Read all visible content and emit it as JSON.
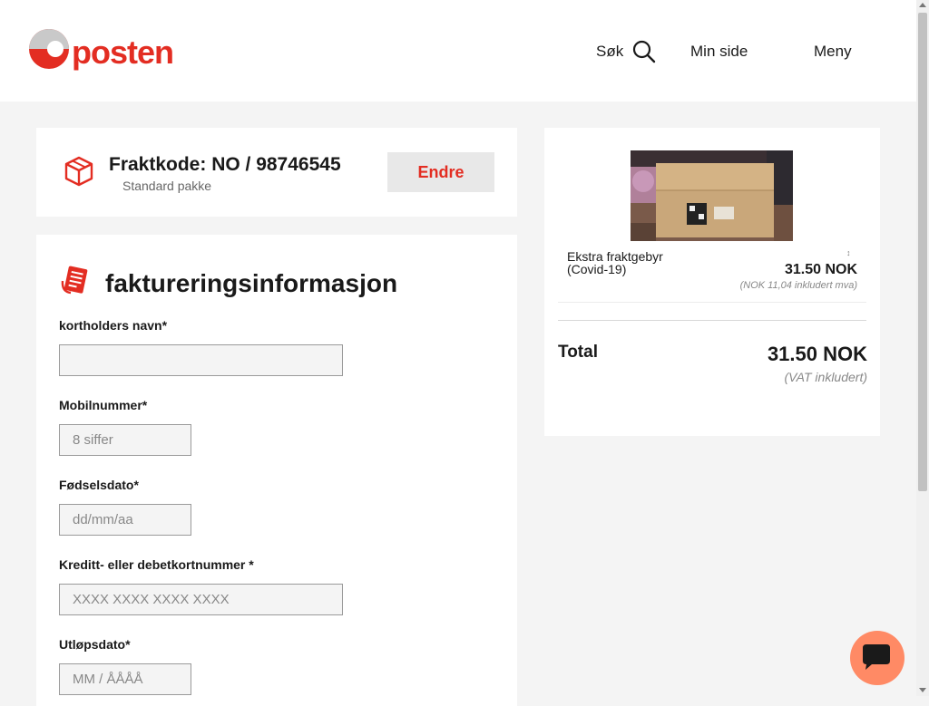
{
  "header": {
    "logo_text": "posten",
    "search_label": "Søk",
    "nav": {
      "min_side": "Min side",
      "meny": "Meny"
    }
  },
  "freight": {
    "code_label": "Fraktkode: NO / 98746545",
    "type": "Standard pakke",
    "change_button": "Endre"
  },
  "billing": {
    "title": "faktureringsinformasjon",
    "fields": [
      {
        "label": "kortholders navn*",
        "value": "",
        "placeholder": ""
      },
      {
        "label": "Mobilnummer*",
        "value": "",
        "placeholder": "8 siffer"
      },
      {
        "label": "Fødselsdato*",
        "value": "",
        "placeholder": "dd/mm/aa"
      },
      {
        "label": "Kreditt- eller debetkortnummer *",
        "value": "",
        "placeholder": "XXXX XXXX XXXX XXXX"
      },
      {
        "label": "Utløpsdato*",
        "value": "",
        "placeholder": "MM / ÅÅÅÅ"
      }
    ]
  },
  "summary": {
    "item_name": "Ekstra fraktgebyr (Covid-19)",
    "item_price": "31.50 NOK",
    "item_vat": "(NOK 11,04 inkludert mva)",
    "total_label": "Total",
    "total_value": "31.50 NOK",
    "total_vat": "(VAT inkludert)"
  },
  "colors": {
    "brand_red": "#e32d22",
    "chat_button": "#ff8a65",
    "page_bg": "#f4f4f4"
  }
}
